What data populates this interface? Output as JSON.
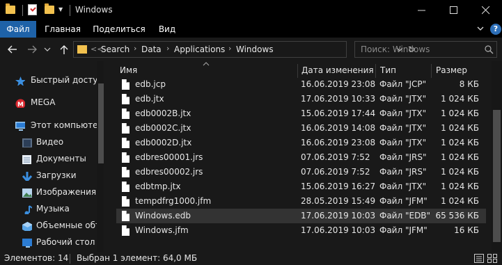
{
  "window": {
    "title": "Windows"
  },
  "ribbon": {
    "tabs": [
      {
        "label": "Файл",
        "active": true
      },
      {
        "label": "Главная"
      },
      {
        "label": "Поделиться"
      },
      {
        "label": "Вид"
      }
    ],
    "help": "?"
  },
  "address": {
    "prefix": "<<",
    "crumbs": [
      "Search",
      "Data",
      "Applications",
      "Windows"
    ]
  },
  "search": {
    "placeholder": "Поиск: Windows"
  },
  "nav_pane": {
    "items": [
      {
        "label": "Быстрый доступ",
        "icon": "star-icon"
      },
      {
        "label": "MEGA",
        "icon": "mega-icon"
      },
      {
        "label": "Этот компьютер",
        "icon": "computer-icon"
      },
      {
        "label": "Видео",
        "icon": "video-icon"
      },
      {
        "label": "Документы",
        "icon": "documents-icon"
      },
      {
        "label": "Загрузки",
        "icon": "downloads-icon"
      },
      {
        "label": "Изображения",
        "icon": "pictures-icon"
      },
      {
        "label": "Музыка",
        "icon": "music-icon"
      },
      {
        "label": "Объемные объ",
        "icon": "3d-objects-icon"
      },
      {
        "label": "Рабочий стол",
        "icon": "desktop-icon"
      }
    ]
  },
  "columns": {
    "name": "Имя",
    "date": "Дата изменения",
    "type": "Тип",
    "size": "Размер"
  },
  "files": [
    {
      "name": "edb.jcp",
      "date": "16.06.2019 23:08",
      "type": "Файл \"JCP\"",
      "size": "8 КБ"
    },
    {
      "name": "edb.jtx",
      "date": "17.06.2019 10:33",
      "type": "Файл \"JTX\"",
      "size": "1 024 КБ"
    },
    {
      "name": "edb0002B.jtx",
      "date": "15.06.2019 17:44",
      "type": "Файл \"JTX\"",
      "size": "1 024 КБ"
    },
    {
      "name": "edb0002C.jtx",
      "date": "16.06.2019 14:08",
      "type": "Файл \"JTX\"",
      "size": "1 024 КБ"
    },
    {
      "name": "edb0002D.jtx",
      "date": "16.06.2019 23:08",
      "type": "Файл \"JTX\"",
      "size": "1 024 КБ"
    },
    {
      "name": "edbres00001.jrs",
      "date": "07.06.2019 7:52",
      "type": "Файл \"JRS\"",
      "size": "1 024 КБ"
    },
    {
      "name": "edbres00002.jrs",
      "date": "07.06.2019 7:52",
      "type": "Файл \"JRS\"",
      "size": "1 024 КБ"
    },
    {
      "name": "edbtmp.jtx",
      "date": "15.06.2019 16:27",
      "type": "Файл \"JTX\"",
      "size": "1 024 КБ"
    },
    {
      "name": "tempdfrg1000.jfm",
      "date": "28.05.2019 15:49",
      "type": "Файл \"JFM\"",
      "size": "1 024 КБ"
    },
    {
      "name": "Windows.edb",
      "date": "17.06.2019 10:03",
      "type": "Файл \"EDB\"",
      "size": "65 536 КБ",
      "selected": true
    },
    {
      "name": "Windows.jfm",
      "date": "17.06.2019 10:03",
      "type": "Файл \"JFM\"",
      "size": "16 КБ"
    }
  ],
  "status": {
    "count": "Элементов: 14",
    "selection": "Выбран 1 элемент: 64,0 МБ"
  },
  "colors": {
    "accent": "#1e62a8",
    "folder": "#f2c14e",
    "selected_row": "#333333"
  }
}
